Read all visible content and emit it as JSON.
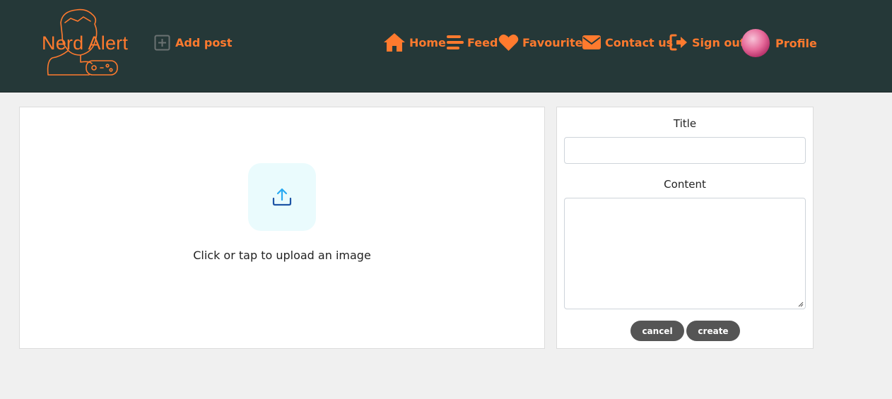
{
  "brand": {
    "name": "Nerd Alert",
    "accent": "#ff7a2e",
    "nav_bg": "#253838"
  },
  "nav": {
    "add_post": {
      "label": "Add post",
      "icon": "plus-square-icon"
    },
    "links": [
      {
        "label": "Home",
        "icon": "home-icon"
      },
      {
        "label": "Feed",
        "icon": "feed-icon"
      },
      {
        "label": "Favourites",
        "icon": "heart-icon"
      },
      {
        "label": "Contact us",
        "icon": "envelope-icon"
      },
      {
        "label": "Sign out",
        "icon": "sign-out-icon"
      },
      {
        "label": "Profile",
        "icon": "avatar"
      }
    ]
  },
  "upload": {
    "prompt": "Click or tap to upload an image",
    "icon": "upload-icon"
  },
  "form": {
    "title_label": "Title",
    "title_value": "",
    "content_label": "Content",
    "content_value": "",
    "cancel_label": "cancel",
    "create_label": "create"
  }
}
